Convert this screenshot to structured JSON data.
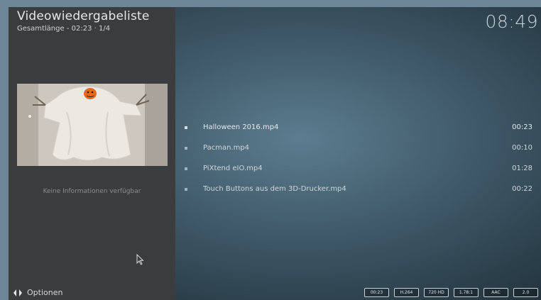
{
  "header": {
    "title": "Videowiedergabeliste",
    "subtitle": "Gesamtlänge - 02:23  ·  1/4",
    "clock": "08:49"
  },
  "sidebar": {
    "thumbnail_icon": "ghost-video-thumbnail",
    "no_info_text": "Keine Informationen verfügbar",
    "options_label": "Optionen",
    "options_icon": "arrows-left-right-icon"
  },
  "playlist": {
    "items": [
      {
        "name": "Halloween 2016.mp4",
        "duration": "00:23"
      },
      {
        "name": "Pacman.mp4",
        "duration": "00:10"
      },
      {
        "name": "PiXtend eIO.mp4",
        "duration": "01:28"
      },
      {
        "name": "Touch Buttons aus dem 3D-Drucker.mp4",
        "duration": "00:22"
      }
    ]
  },
  "media_info": {
    "badges": [
      "00:23",
      "H.264",
      "720 HD",
      "1.78:1",
      "AAC",
      "2.0"
    ]
  },
  "colors": {
    "sidebar": "#3a3c3e",
    "background": "#3e5766",
    "text": "#e3e8ea"
  }
}
